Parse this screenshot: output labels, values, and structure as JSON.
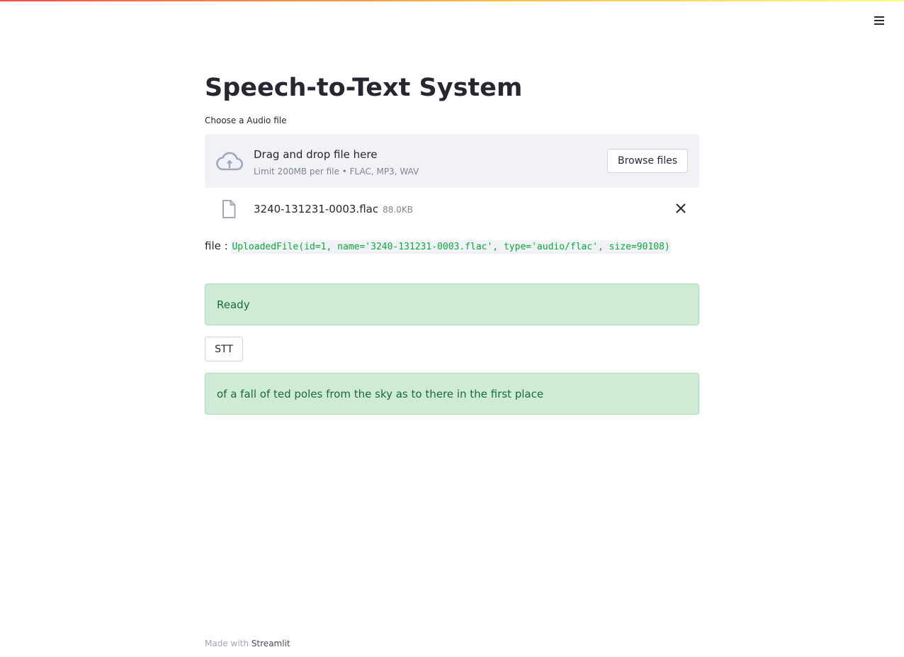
{
  "header": {
    "menu_icon": "hamburger-menu-icon",
    "decoration_colors": [
      "#ff4b4b",
      "#ffbd45",
      "#fffd80"
    ]
  },
  "page": {
    "title": "Speech-to-Text System"
  },
  "uploader": {
    "label": "Choose a Audio file",
    "drop_title": "Drag and drop file here",
    "limit_text": "Limit 200MB per file • FLAC, MP3, WAV",
    "browse_label": "Browse files",
    "icon": "cloud-upload-icon"
  },
  "uploaded_file": {
    "name": "3240-131231-0003.flac",
    "size": "88.0KB",
    "icon": "file-icon",
    "remove_icon": "close-icon"
  },
  "file_info": {
    "prefix": "file :",
    "code": "UploadedFile(id=1, name='3240-131231-0003.flac', type='audio/flac', size=90108)"
  },
  "status": {
    "ready_text": "Ready",
    "color": "#cfebd5",
    "text_color": "#176c37"
  },
  "actions": {
    "stt_label": "STT"
  },
  "result": {
    "text": "of a fall of ted poles from the sky as to there in the first place"
  },
  "footer": {
    "prefix": "Made with",
    "link": "Streamlit"
  }
}
